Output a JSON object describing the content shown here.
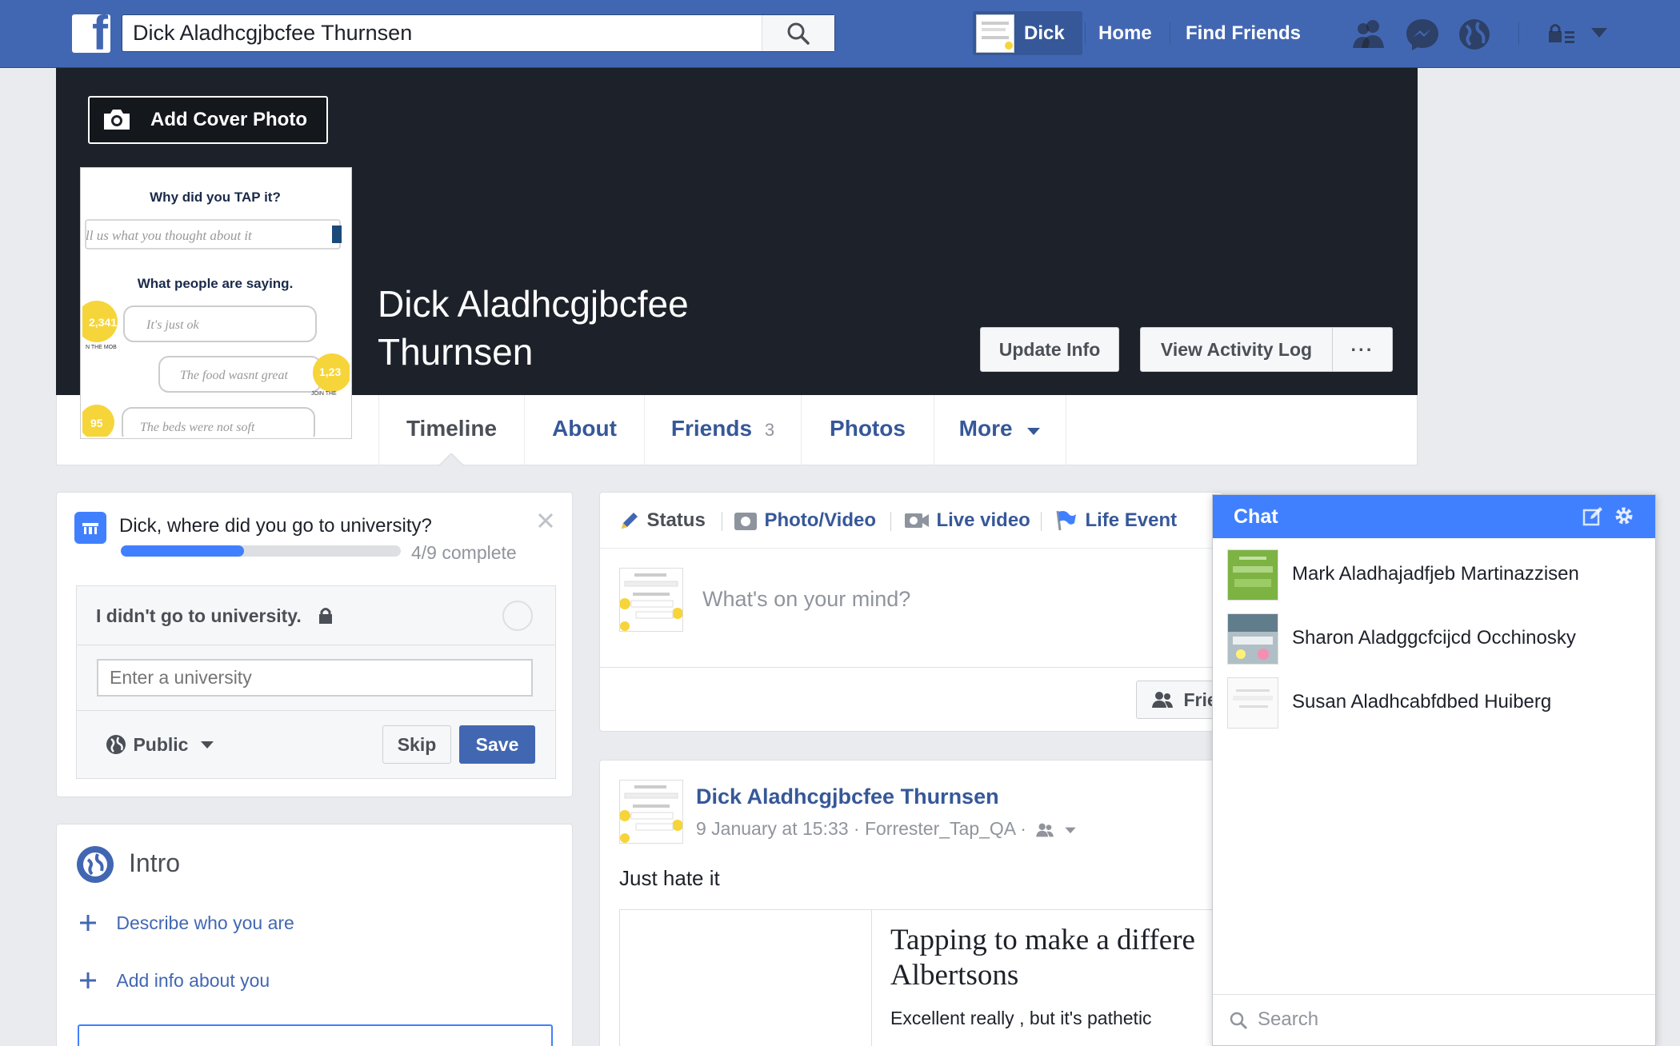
{
  "topbar": {
    "logo": "f",
    "search_value": "Dick Aladhcgjbcfee Thurnsen",
    "profile_name": "Dick",
    "home": "Home",
    "find_friends": "Find Friends"
  },
  "cover": {
    "add_cover_photo": "Add Cover Photo",
    "name_line1": "Dick Aladhcgjbcfee",
    "name_line2": "Thurnsen",
    "update_info": "Update Info",
    "view_activity_log": "View Activity Log",
    "more_dots": "···"
  },
  "profile_pic": {
    "heading1": "Why did you TAP it?",
    "field1": "ll us what you thought about it",
    "heading2": "What people are saying.",
    "bubble1": "It's just ok",
    "bubble2": "The food wasnt great",
    "bubble3": "The beds were not soft",
    "badge1": "2,341",
    "badge2": "1,23",
    "badge3": "95",
    "tag1": "N THE MOB",
    "tag2": "JOIN THE"
  },
  "tabs": [
    {
      "label": "Timeline"
    },
    {
      "label": "About"
    },
    {
      "label": "Friends",
      "count": "3"
    },
    {
      "label": "Photos"
    },
    {
      "label": "More"
    }
  ],
  "university": {
    "question": "Dick, where did you go to university?",
    "progress_fraction": 0.44,
    "progress_text": "4/9 complete",
    "option": "I didn't go to university.",
    "input_placeholder": "Enter a university",
    "privacy": "Public",
    "skip": "Skip",
    "save": "Save"
  },
  "intro": {
    "title": "Intro",
    "describe": "Describe who you are",
    "add_info": "Add info about you"
  },
  "composer": {
    "status": "Status",
    "photo_video": "Photo/Video",
    "live_video": "Live video",
    "life_event": "Life Event",
    "placeholder": "What's on your mind?",
    "friends_btn": "Frie"
  },
  "post": {
    "author": "Dick Aladhcgjbcfee Thurnsen",
    "meta": "9 January at 15:33 · Forrester_Tap_QA ·",
    "text": "Just hate it",
    "link_title_line1": "Tapping to make a differe",
    "link_title_line2": "Albertsons",
    "link_desc": "Excellent really , but it's pathetic"
  },
  "chat": {
    "title": "Chat",
    "contacts": [
      {
        "name": "Mark Aladhajadfjeb Martinazzisen"
      },
      {
        "name": "Sharon Aladggcfcijcd Occhinosky"
      },
      {
        "name": "Susan Aladhcabfdbed Huiberg"
      }
    ],
    "search_placeholder": "Search"
  },
  "colors": {
    "brand": "#4267b2",
    "chat_header": "#4080ff",
    "link": "#365899"
  }
}
